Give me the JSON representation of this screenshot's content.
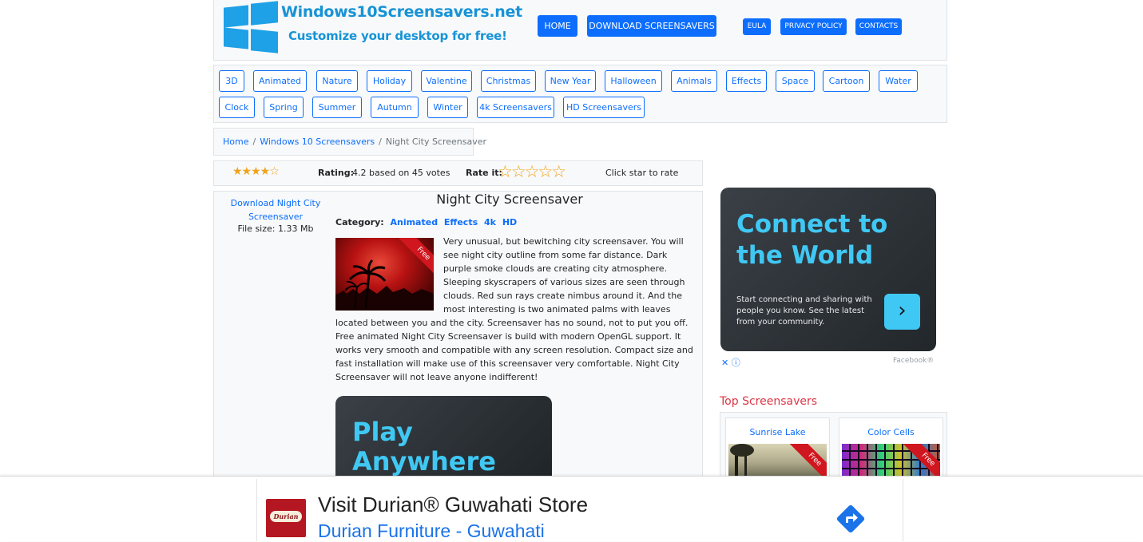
{
  "site": {
    "title": "Windows10Screensavers.net",
    "tagline": "Customize your desktop for free!"
  },
  "nav": {
    "home": "HOME",
    "download": "DOWNLOAD SCREENSAVERS",
    "eula": "EULA",
    "privacy": "PRIVACY POLICY",
    "contacts": "CONTACTS"
  },
  "categories": [
    "3D",
    "Animated",
    "Nature",
    "Holiday",
    "Valentine",
    "Christmas",
    "New Year",
    "Halloween",
    "Animals",
    "Effects",
    "Space",
    "Cartoon",
    "Water",
    "Clock",
    "Spring",
    "Summer",
    "Autumn",
    "Winter",
    "4k Screensavers",
    "HD Screensavers"
  ],
  "breadcrumb": {
    "home": "Home",
    "section": "Windows 10 Screensavers",
    "current": "Night City Screensaver",
    "sep": "/"
  },
  "rating": {
    "stars_display": "★★★★☆",
    "label": "Rating:",
    "value_text": "4.2 based on 45 votes",
    "rate_label": "Rate it:",
    "rate_stars": "☆☆☆☆☆",
    "hint": "Click star to rate",
    "value": 4.2
  },
  "screensaver": {
    "download_link": "Download Night City Screensaver",
    "file_size": "File size: 1.33 Mb",
    "title": "Night City Screensaver",
    "category_label": "Category:",
    "categories": [
      "Animated",
      "Effects",
      "4k",
      "HD"
    ],
    "ribbon": "Free",
    "description": "Very unusual, but bewitching city screensaver. You will see night city outline from some far distance. Dark purple smoke clouds are creating city atmosphere. Sleeping skyscrapers of various sizes are seen through clouds. Red sun rays create nimbus around it. And the most interesting is two animated palms with leaves located between you and the city. Screensaver has no sound, not to put you off. Free animated Night City Screensaver is build with modern OpenGL support. It works very smooth and compatible with any screen resolution. Compact size and fast installation will make use of this screensaver very comfortable. Night City Screensaver will not leave anyone indifferent!"
  },
  "play_ad": {
    "line1": "Play",
    "line2": "Anywhere"
  },
  "right_ad": {
    "line1": "Connect to",
    "line2": "the World",
    "body": "Start connecting and sharing with people you know. See the latest from your community.",
    "arrow": "›",
    "choice": "✕ ⓘ",
    "source": "Facebook®"
  },
  "top_screensavers": {
    "heading": "Top Screensavers",
    "items": [
      {
        "label": "Sunrise Lake",
        "ribbon": "Free"
      },
      {
        "label": "Color Cells",
        "ribbon": "Free"
      }
    ]
  },
  "banner": {
    "logo_text": "Durian",
    "title": "Visit Durian® Guwahati Store",
    "subtitle": "Durian Furniture - Guwahati"
  },
  "colors": {
    "primary": "#0d6efd",
    "brand": "#1793d6",
    "ad_accent": "#40c8f4",
    "heading_red": "#dc3545",
    "star": "#f0a21b"
  }
}
